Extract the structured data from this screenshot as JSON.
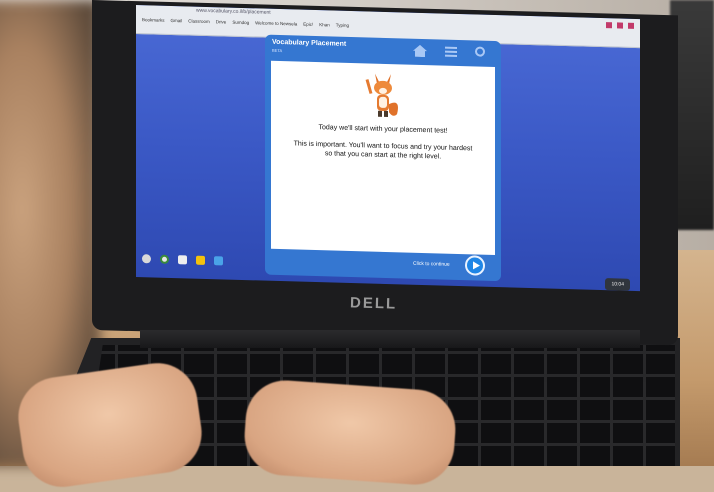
{
  "browser": {
    "url": "www.vocabulary.co.il/b/placement",
    "bookmarks": [
      "Bookmarks",
      "Gmail",
      "Classroom",
      "Drive",
      "Sumdog",
      "Welcome to Newsela",
      "Epic!",
      "Khan",
      "Typing"
    ]
  },
  "app": {
    "title": "Vocabulary Placement",
    "subtitle": "BETA",
    "message_line1": "Today we'll start with your placement test!",
    "message_line2": "This is important. You'll want to focus and try your hardest so that you can start at the right level.",
    "continue_label": "Click to continue"
  },
  "taskbar": {
    "time": "10:04"
  },
  "laptop": {
    "brand": "DELL"
  },
  "colors": {
    "screen_bg": "#3b59c6",
    "app_blue": "#3577d1",
    "continue_blue": "#1f86e6"
  }
}
